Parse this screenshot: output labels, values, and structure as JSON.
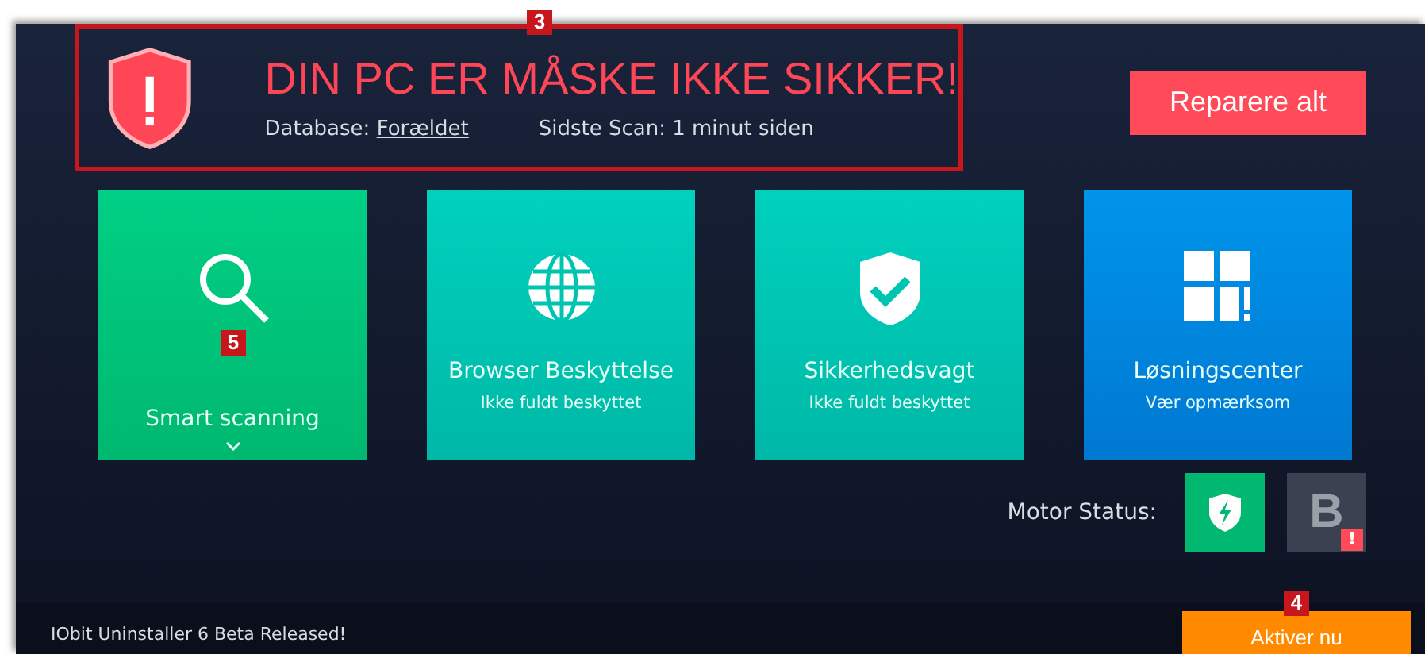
{
  "alert": {
    "callout": "3",
    "title": "DIN PC ER MÅSKE IKKE SIKKER!",
    "database_label": "Database:",
    "database_value": "Forældet",
    "last_scan": "Sidste Scan: 1 minut siden"
  },
  "repair_button": "Reparere alt",
  "tiles": [
    {
      "kind": "scan",
      "title": "Smart scanning",
      "callout": "5",
      "expandable": true
    },
    {
      "kind": "browser",
      "title": "Browser Beskyttelse",
      "subtitle": "Ikke fuldt beskyttet"
    },
    {
      "kind": "guard",
      "title": "Sikkerhedsvagt",
      "subtitle": "Ikke fuldt beskyttet"
    },
    {
      "kind": "solution",
      "title": "Løsningscenter",
      "subtitle": "Vær opmærksom"
    }
  ],
  "motor_status": {
    "label": "Motor Status:",
    "engines": [
      {
        "kind": "shield",
        "warning": false
      },
      {
        "kind": "letter",
        "letter": "B",
        "warning": true,
        "warning_mark": "!"
      }
    ]
  },
  "news": "IObit Uninstaller 6 Beta Released!",
  "activate": {
    "label": "Aktiver nu",
    "callout": "4"
  }
}
